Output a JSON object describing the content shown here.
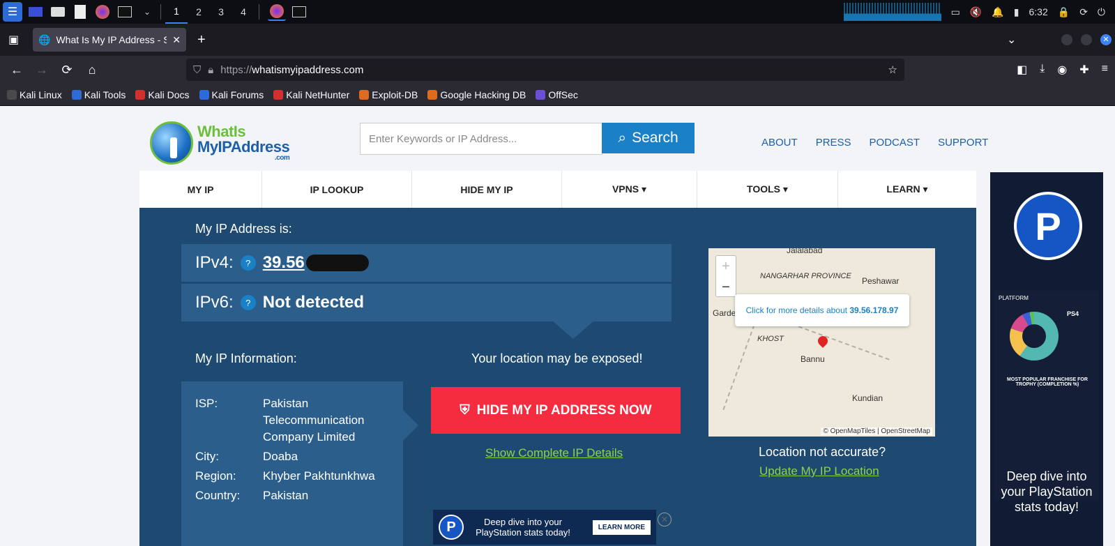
{
  "taskbar": {
    "workspaces": [
      "1",
      "2",
      "3",
      "4"
    ],
    "clock": "6:32"
  },
  "browser": {
    "tab_title": "What Is My IP Address - S",
    "url_proto": "https://",
    "url_domain": "whatismyipaddress.com",
    "bookmarks": [
      "Kali Linux",
      "Kali Tools",
      "Kali Docs",
      "Kali Forums",
      "Kali NetHunter",
      "Exploit-DB",
      "Google Hacking DB",
      "OffSec"
    ],
    "bookmark_colors": [
      "#4a4a4a",
      "#2d6bd6",
      "#d32f2f",
      "#2d6bd6",
      "#d32f2f",
      "#e06b1f",
      "#e06b1f",
      "#6b4fd6"
    ]
  },
  "site": {
    "logo": {
      "line1": "WhatIs",
      "line2": "MyIPAddress",
      "line3": ".com"
    },
    "search": {
      "placeholder": "Enter Keywords or IP Address...",
      "button": "Search"
    },
    "top_links": [
      "ABOUT",
      "PRESS",
      "PODCAST",
      "SUPPORT"
    ],
    "nav": [
      "MY IP",
      "IP LOOKUP",
      "HIDE MY IP",
      "VPNS ▾",
      "TOOLS ▾",
      "LEARN ▾"
    ],
    "my_ip_label": "My IP Address is:",
    "ipv4_label": "IPv4:",
    "ipv4_value": "39.56",
    "ipv6_label": "IPv6:",
    "ipv6_value": "Not detected",
    "qmark": "?",
    "info_label": "My IP Information:",
    "info": [
      {
        "k": "ISP:",
        "v": "Pakistan Telecommunication Company Limited"
      },
      {
        "k": "City:",
        "v": "Doaba"
      },
      {
        "k": "Region:",
        "v": "Khyber Pakhtunkhwa"
      },
      {
        "k": "Country:",
        "v": "Pakistan"
      }
    ],
    "exposed_text": "Your location may be exposed!",
    "hide_button": "HIDE MY IP ADDRESS NOW",
    "show_details": "Show Complete IP Details",
    "location_q": "Location not accurate?",
    "update_location": "Update My IP Location",
    "map": {
      "popup_prefix": "Click for more details about",
      "popup_ip": "39.56.178.97",
      "places": [
        "Jalalabad",
        "NANGARHAR PROVINCE",
        "Peshawar",
        "Garde",
        "KHOST",
        "Bannu",
        "Kundian"
      ],
      "attribution": "© OpenMapTiles | OpenStreetMap"
    }
  },
  "ads": {
    "side_platform": "PLATFORM",
    "side_ps4": "PS4",
    "side_franchise": "MOST POPULAR FRANCHISE FOR TROPHY (COMPLETION %)",
    "side_cta": "Deep dive into your PlayStation stats today!",
    "bottom_text": "Deep dive into your PlayStation stats today!",
    "bottom_button": "LEARN MORE",
    "logo_letter": "P"
  }
}
